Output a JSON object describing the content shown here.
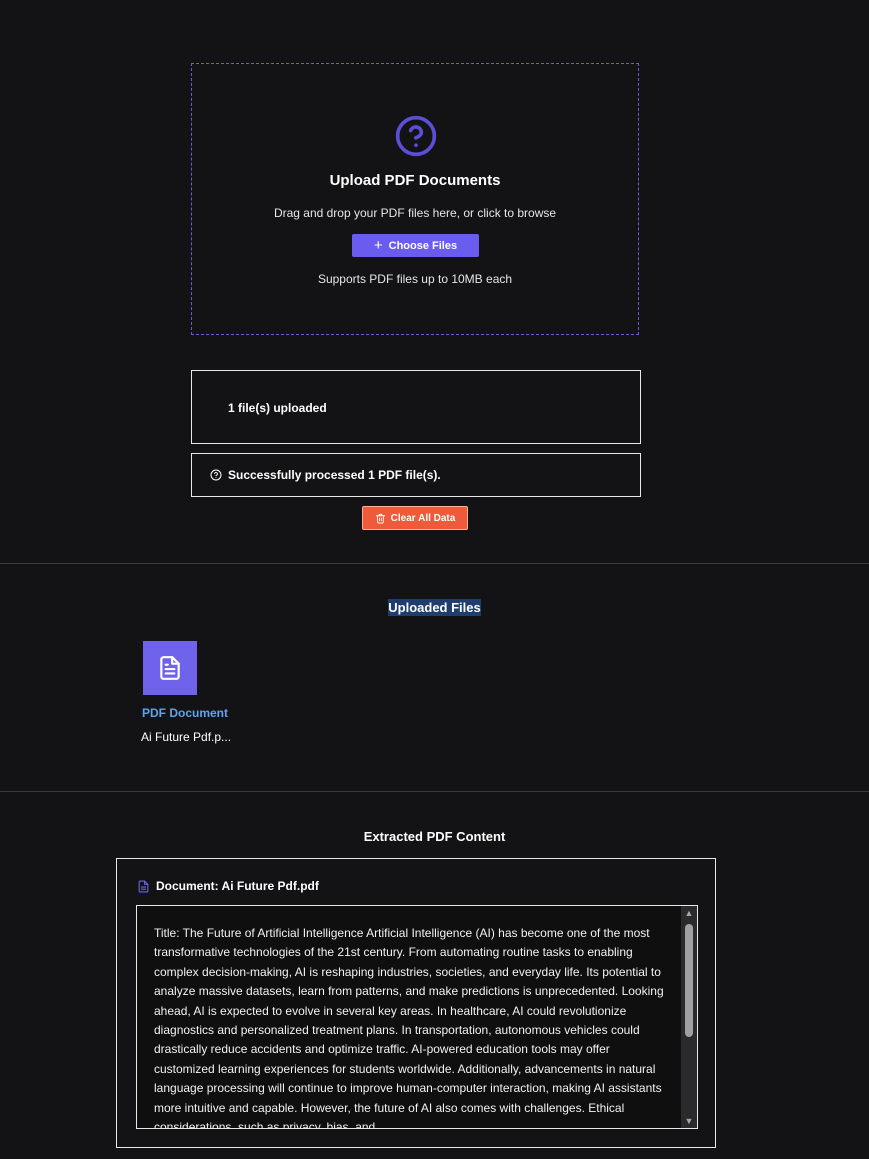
{
  "upload": {
    "title": "Upload PDF Documents",
    "subtitle": "Drag and drop your PDF files here, or click to browse",
    "choose_label": "Choose Files",
    "note": "Supports PDF files up to 10MB each",
    "icon": "help-circle-icon"
  },
  "status": {
    "files_uploaded": "1 file(s) uploaded",
    "processed_message": "Successfully processed 1 PDF file(s).",
    "clear_label": "Clear All Data"
  },
  "uploaded_section": {
    "title": "Uploaded Files",
    "files": [
      {
        "type": "PDF Document",
        "name": "Ai Future Pdf.p..."
      }
    ]
  },
  "extracted_section": {
    "title": "Extracted PDF Content",
    "document_label": "Document: Ai Future Pdf.pdf",
    "content": "Title: The Future of Artificial Intelligence Artificial Intelligence (AI) has become one of the most transformative technologies of the 21st century. From automating routine tasks to enabling complex decision-making, AI is reshaping industries, societies, and everyday life. Its potential to analyze massive datasets, learn from patterns, and make predictions is unprecedented. Looking ahead, AI is expected to evolve in several key areas. In healthcare, AI could revolutionize diagnostics and personalized treatment plans. In transportation, autonomous vehicles could drastically reduce accidents and optimize traffic. AI-powered education tools may offer customized learning experiences for students worldwide. Additionally, advancements in natural language processing will continue to improve human-computer interaction, making AI assistants more intuitive and capable. However, the future of AI also comes with challenges. Ethical considerations, such as privacy, bias, and"
  },
  "colors": {
    "background": "#131315",
    "accent": "#6b5cf0",
    "danger": "#ef5a3a",
    "link": "#5ea3f2"
  }
}
